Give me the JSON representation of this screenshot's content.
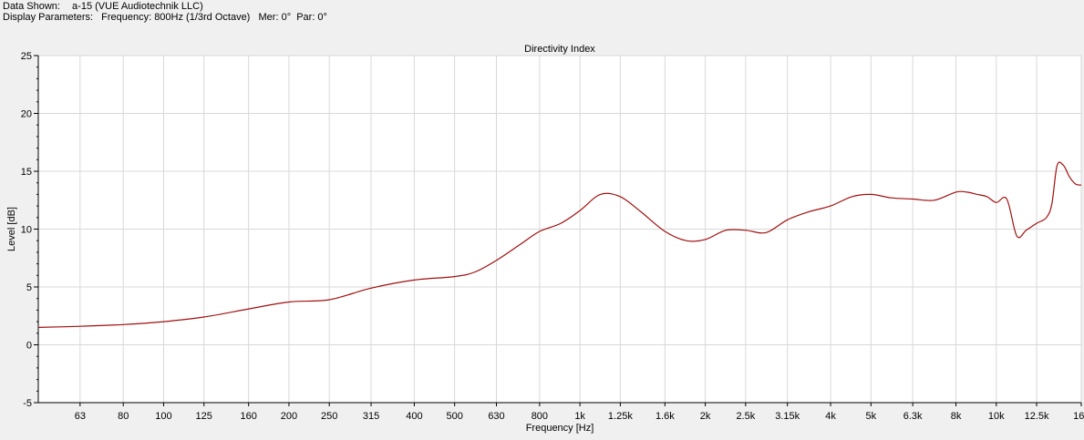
{
  "header": {
    "data_shown_label": "Data Shown:",
    "data_shown_value": "a-15 (VUE Audiotechnik LLC)",
    "display_params_label": "Display Parameters:",
    "display_params_value": "Frequency: 800Hz (1/3rd Octave)   Mer: 0°  Par: 0°"
  },
  "colors": {
    "line": "#a01010",
    "grid": "#d8d8d8",
    "plot_bg": "#ffffff",
    "page_bg": "#f0f0f0"
  },
  "chart_data": {
    "type": "line",
    "title": "Directivity Index",
    "xlabel": "Frequency [Hz]",
    "ylabel": "Level [dB]",
    "xscale": "log",
    "xlim": [
      50,
      16000
    ],
    "ylim": [
      -5,
      25
    ],
    "grid": true,
    "x_ticks": [
      63,
      80,
      100,
      125,
      160,
      200,
      250,
      315,
      400,
      500,
      630,
      800,
      1000,
      1250,
      1600,
      2000,
      2500,
      3150,
      4000,
      5000,
      6300,
      8000,
      10000,
      12500,
      16000
    ],
    "x_tick_labels": [
      "63",
      "80",
      "100",
      "125",
      "160",
      "200",
      "250",
      "315",
      "400",
      "500",
      "630",
      "800",
      "1k",
      "1.25k",
      "1.6k",
      "2k",
      "2.5k",
      "3.15k",
      "4k",
      "5k",
      "6.3k",
      "8k",
      "10k",
      "12.5k",
      "16k"
    ],
    "y_ticks": [
      -5,
      0,
      5,
      10,
      15,
      20,
      25
    ],
    "y_tick_labels": [
      "-5",
      "0",
      "5",
      "10",
      "15",
      "20",
      "25"
    ],
    "series": [
      {
        "x": [
          50,
          63,
          80,
          100,
          125,
          160,
          200,
          250,
          315,
          400,
          500,
          560,
          630,
          720,
          800,
          900,
          1000,
          1120,
          1250,
          1400,
          1600,
          1800,
          2000,
          2240,
          2500,
          2800,
          3150,
          3550,
          4000,
          4500,
          5000,
          5600,
          6300,
          7100,
          8000,
          8500,
          9000,
          9500,
          10000,
          10600,
          11200,
          11800,
          12500,
          13200,
          13600,
          14000,
          14500,
          15000,
          15500,
          16000
        ],
        "y": [
          1.5,
          1.6,
          1.75,
          2.0,
          2.4,
          3.1,
          3.7,
          3.9,
          4.9,
          5.6,
          5.9,
          6.3,
          7.3,
          8.7,
          9.8,
          10.5,
          11.6,
          13.0,
          12.8,
          11.5,
          9.8,
          9.0,
          9.1,
          9.9,
          9.9,
          9.7,
          10.8,
          11.5,
          12.0,
          12.8,
          13.0,
          12.7,
          12.6,
          12.5,
          13.2,
          13.2,
          13.0,
          12.8,
          12.3,
          12.6,
          9.4,
          9.9,
          10.5,
          11.0,
          12.2,
          15.5,
          15.5,
          14.5,
          13.9,
          13.8
        ]
      }
    ]
  }
}
